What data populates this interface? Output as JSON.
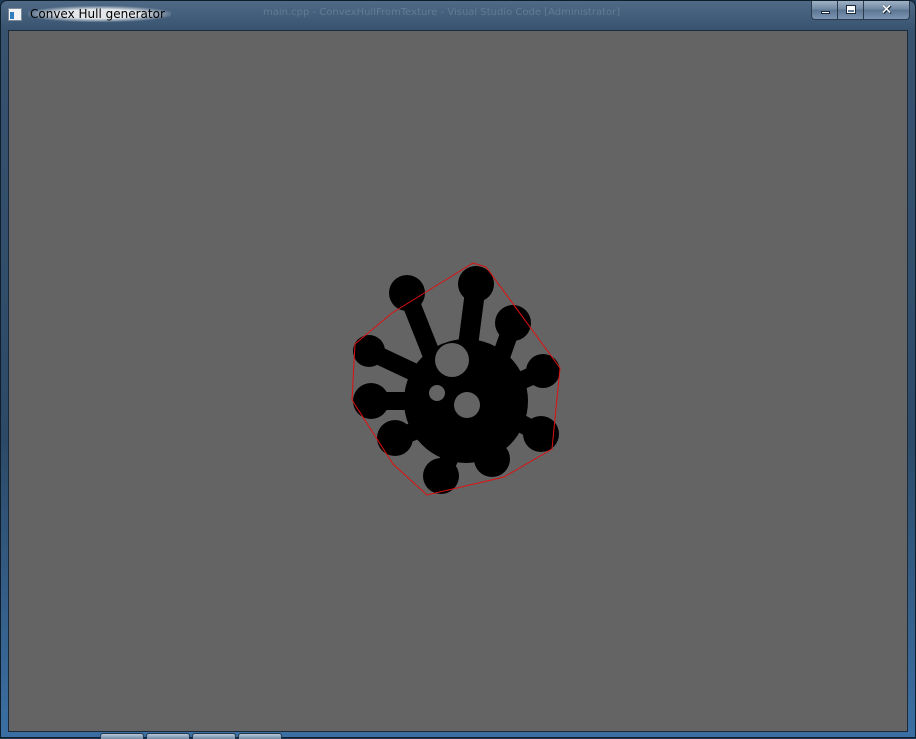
{
  "window": {
    "title": "Convex Hull generator",
    "background_window_title": "main.cpp - ConvexHullFromTexture - Visual Studio Code [Administrator]",
    "app_icon": "window-app-icon",
    "caption_buttons": {
      "minimize_icon": "minimize-icon",
      "maximize_icon": "maximize-icon",
      "close_label": "✕"
    }
  },
  "canvas": {
    "background_color": "#646464",
    "shape_color": "#000000",
    "hull_color": "#e01010",
    "shape_description_icon": "virus-shape-icon"
  },
  "taskbar": {
    "visible_tabs": 4
  }
}
